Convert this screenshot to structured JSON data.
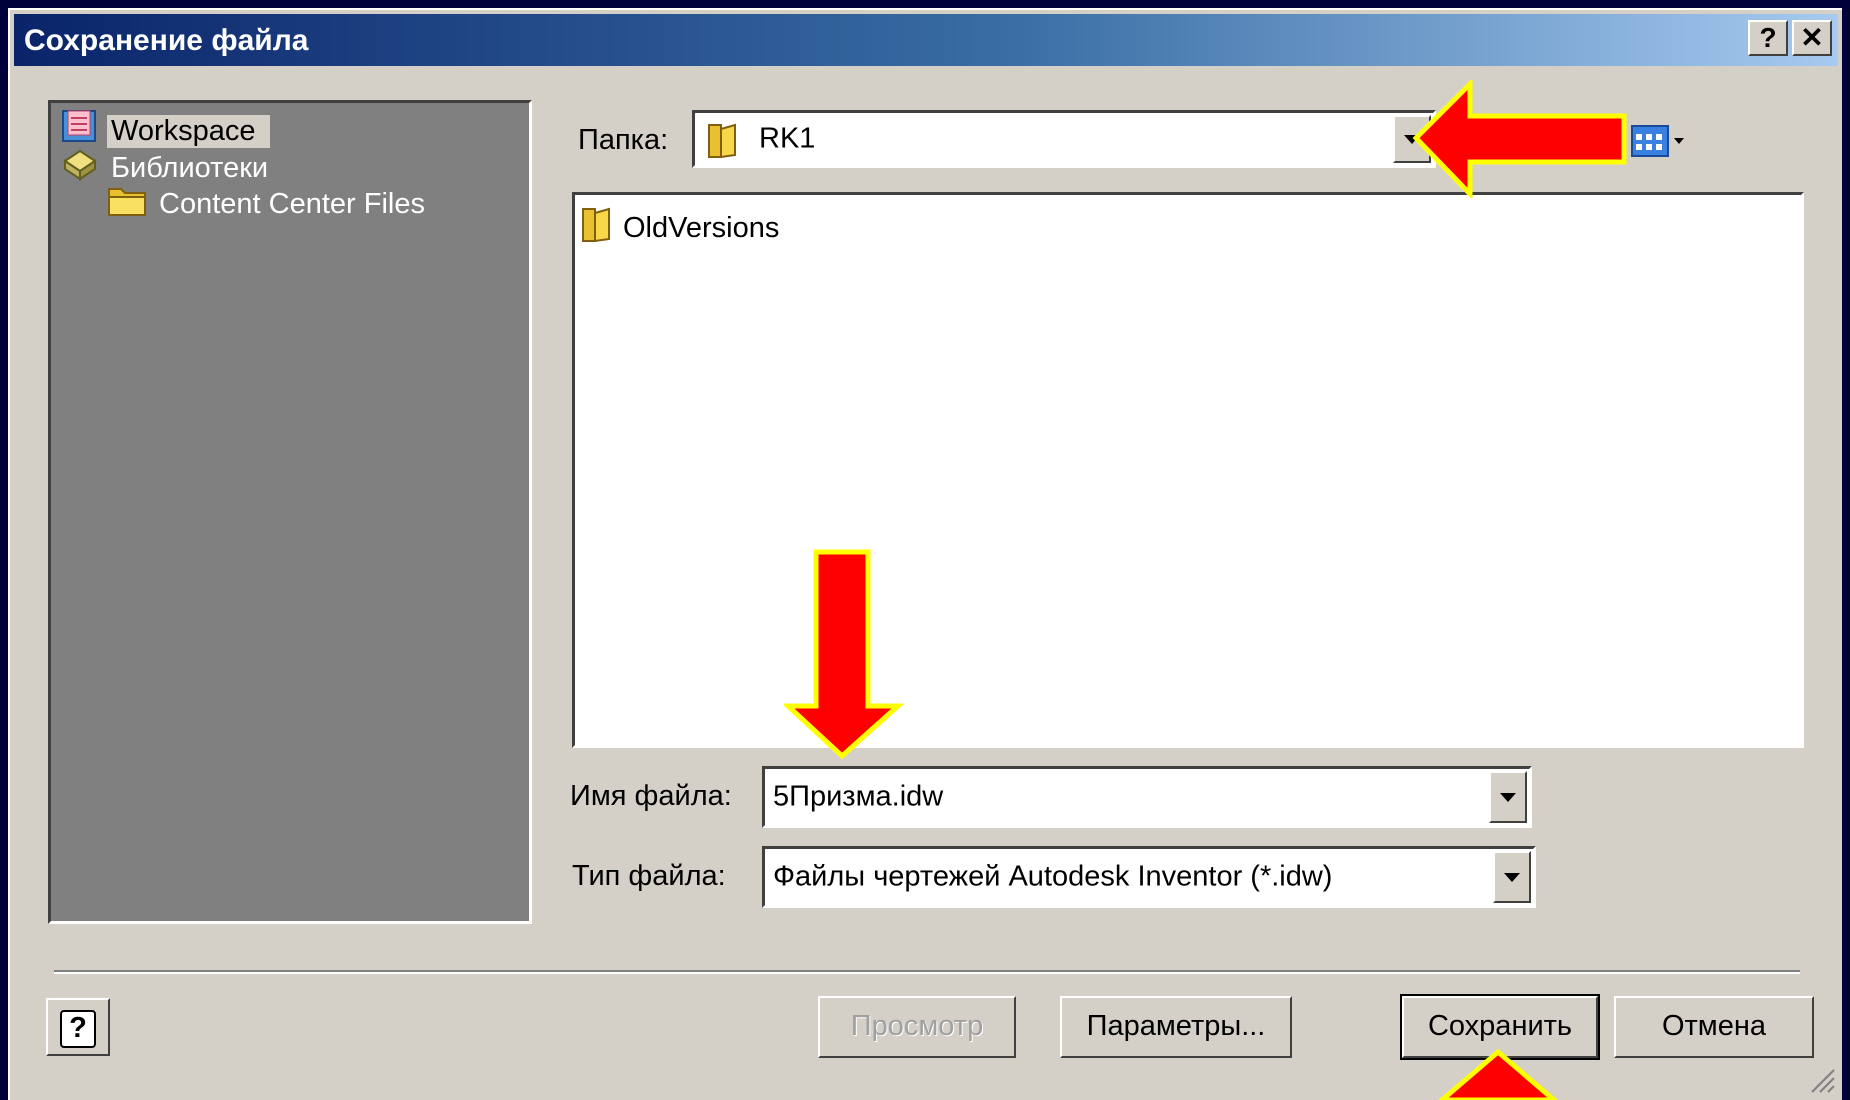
{
  "dialog": {
    "title": "Сохранение файла",
    "help_btn": "?",
    "close_btn": "✕"
  },
  "places": [
    {
      "label": "Workspace",
      "icon": "workspace-icon",
      "selected": true
    },
    {
      "label": "Библиотеки",
      "icon": "libraries-icon"
    },
    {
      "label": "Content Center Files",
      "icon": "folder-icon"
    }
  ],
  "folder": {
    "label": "Папка:",
    "value": "RK1"
  },
  "files": [
    {
      "name": "OldVersions",
      "icon": "folder-icon"
    }
  ],
  "filename": {
    "label": "Имя файла:",
    "value": "5Призма.idw"
  },
  "filetype": {
    "label": "Тип файла:",
    "value": "Файлы чертежей Autodesk Inventor (*.idw)"
  },
  "buttons": {
    "help": "?",
    "preview": "Просмотр",
    "options": "Параметры...",
    "save": "Сохранить",
    "cancel": "Отмена"
  },
  "colors": {
    "annotation_arrow": "#ff0000",
    "annotation_outline": "#ffff00",
    "title_bar_start": "#0a246a"
  }
}
